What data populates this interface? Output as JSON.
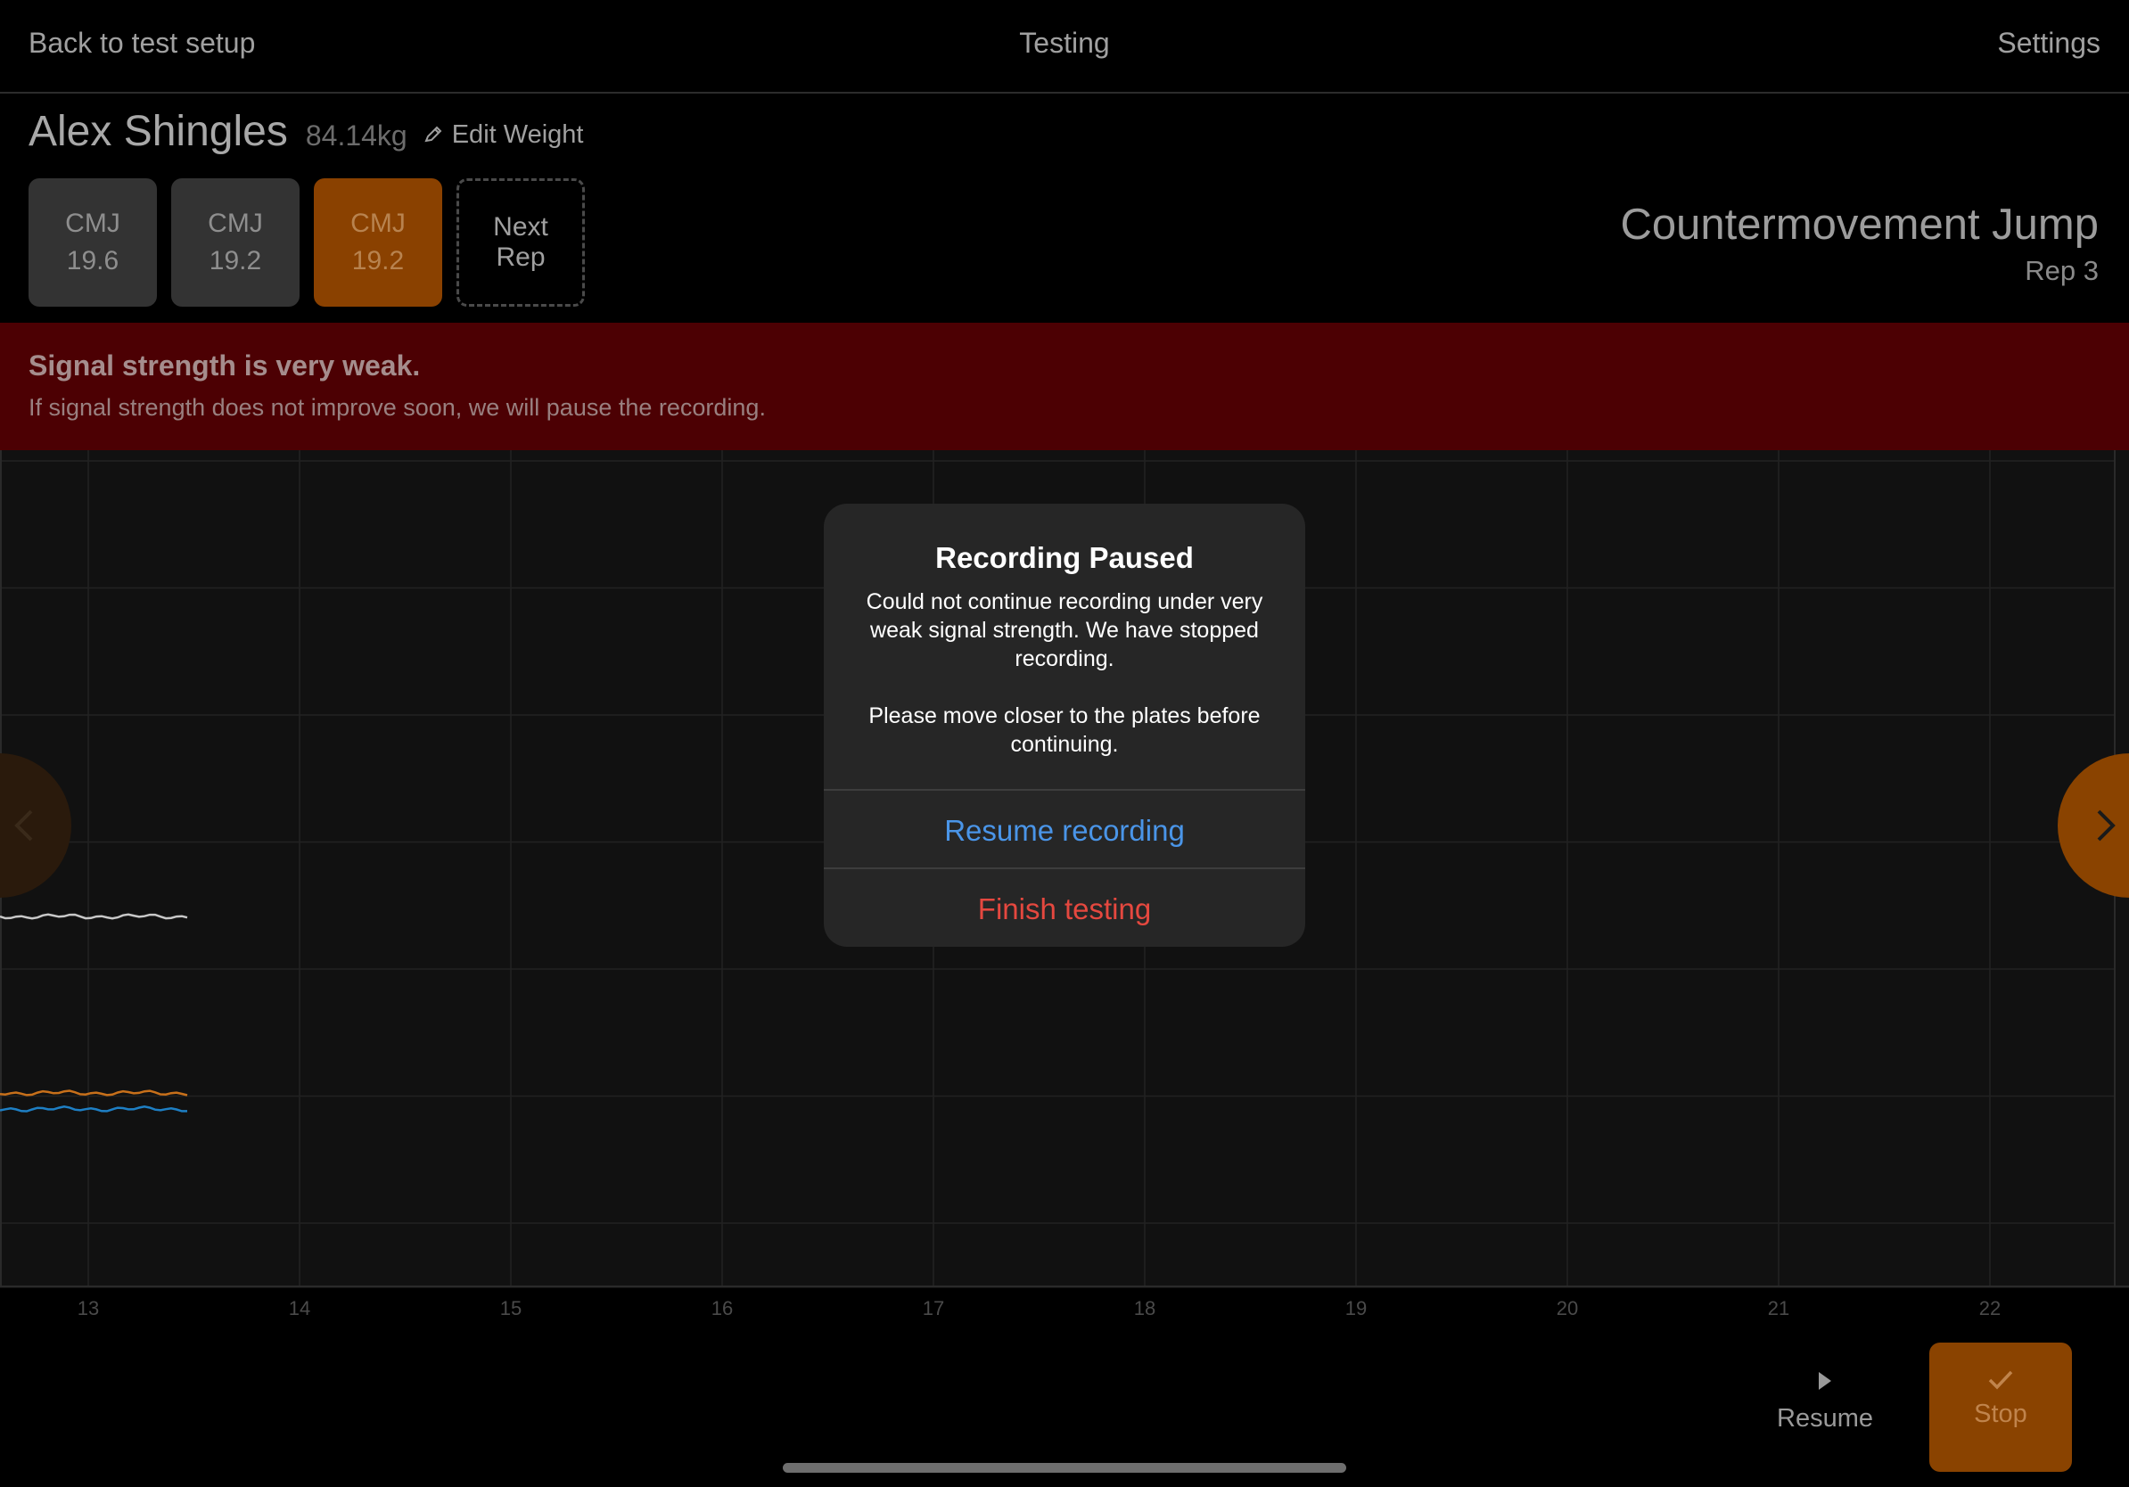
{
  "nav": {
    "back_label": "Back to test setup",
    "title": "Testing",
    "settings_label": "Settings"
  },
  "athlete": {
    "name": "Alex Shingles",
    "weight": "84.14kg",
    "edit_weight_label": "Edit Weight"
  },
  "reps": [
    {
      "type": "CMJ",
      "value": "19.6"
    },
    {
      "type": "CMJ",
      "value": "19.2"
    },
    {
      "type": "CMJ",
      "value": "19.2"
    }
  ],
  "next_rep": {
    "line1": "Next",
    "line2": "Rep"
  },
  "test": {
    "name": "Countermovement Jump",
    "rep_label": "Rep 3"
  },
  "banner": {
    "title": "Signal strength is very weak.",
    "message": "If signal strength does not improve soon, we will pause the recording."
  },
  "chart_data": {
    "type": "line",
    "x_ticks": [
      "13",
      "14",
      "15",
      "16",
      "17",
      "18",
      "19",
      "20",
      "21",
      "22"
    ],
    "grid": true,
    "series_colors": [
      "#c8c8c8",
      "#c8701a",
      "#1e7fc4"
    ]
  },
  "modal": {
    "title": "Recording Paused",
    "message": "Could not continue recording under very weak signal strength. We have stopped recording.\n\nPlease move closer to the plates before continuing.",
    "resume_label": "Resume recording",
    "finish_label": "Finish testing"
  },
  "controls": {
    "resume_label": "Resume",
    "stop_label": "Stop"
  },
  "colors": {
    "accent": "#8a4300",
    "banner": "#4c0003",
    "link_blue": "#4a95e8",
    "destructive_red": "#e5483f"
  }
}
